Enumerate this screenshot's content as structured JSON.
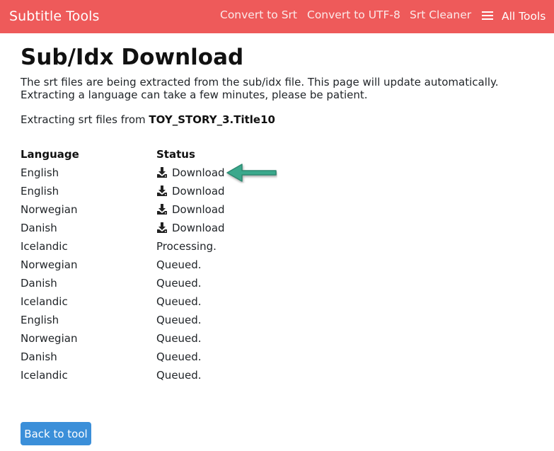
{
  "navbar": {
    "brand": "Subtitle Tools",
    "links": [
      "Convert to Srt",
      "Convert to UTF-8",
      "Srt Cleaner"
    ],
    "all_tools": "All Tools",
    "color": "#ee5a5a"
  },
  "page": {
    "title": "Sub/Idx Download",
    "intro": "The srt files are being extracted from the sub/idx file. This page will update automatically. Extracting a language can take a few minutes, please be patient.",
    "extracting_prefix": "Extracting srt files from ",
    "filename": "TOY_STORY_3.Title10"
  },
  "table": {
    "headers": {
      "language": "Language",
      "status": "Status"
    },
    "rows": [
      {
        "language": "English",
        "status": "Download",
        "downloadable": true
      },
      {
        "language": "English",
        "status": "Download",
        "downloadable": true
      },
      {
        "language": "Norwegian",
        "status": "Download",
        "downloadable": true
      },
      {
        "language": "Danish",
        "status": "Download",
        "downloadable": true
      },
      {
        "language": "Icelandic",
        "status": "Processing.",
        "downloadable": false
      },
      {
        "language": "Norwegian",
        "status": "Queued.",
        "downloadable": false
      },
      {
        "language": "Danish",
        "status": "Queued.",
        "downloadable": false
      },
      {
        "language": "Icelandic",
        "status": "Queued.",
        "downloadable": false
      },
      {
        "language": "English",
        "status": "Queued.",
        "downloadable": false
      },
      {
        "language": "Norwegian",
        "status": "Queued.",
        "downloadable": false
      },
      {
        "language": "Danish",
        "status": "Queued.",
        "downloadable": false
      },
      {
        "language": "Icelandic",
        "status": "Queued.",
        "downloadable": false
      }
    ]
  },
  "annotation": {
    "icon": "arrow-left-icon",
    "color": "#3aa88c"
  },
  "back_button": {
    "label": "Back to tool",
    "color": "#3b8fd9"
  },
  "icons": {
    "download": "download-icon",
    "menu": "hamburger-menu-icon"
  }
}
